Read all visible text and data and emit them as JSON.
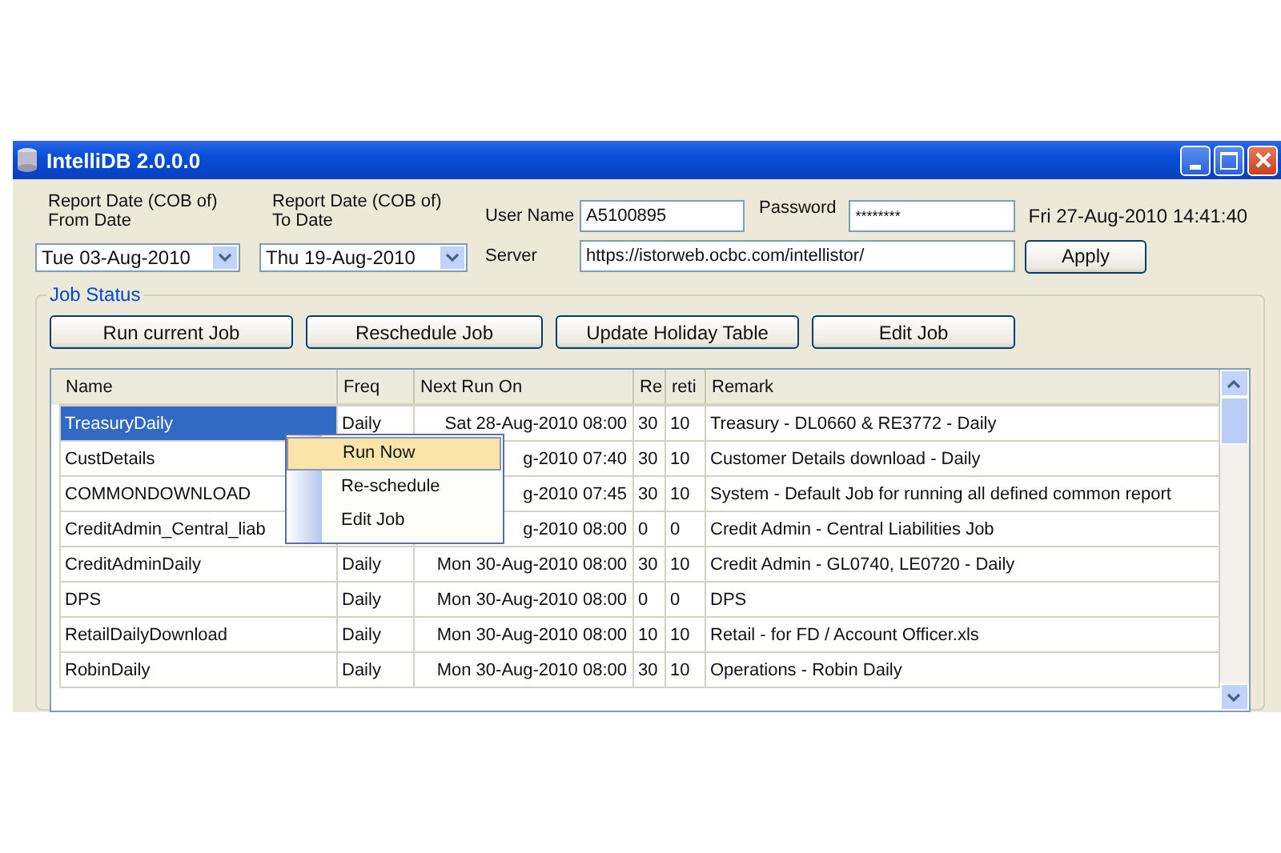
{
  "window": {
    "title": "IntelliDB 2.0.0.0"
  },
  "form": {
    "from_label": "Report Date (COB of)\nFrom Date",
    "from_value": "Tue 03-Aug-2010",
    "to_label": "Report Date (COB of)\nTo Date",
    "to_value": "Thu 19-Aug-2010",
    "user_label": "User Name",
    "user_value": "A5100895",
    "password_label": "Password",
    "password_value": "********",
    "datetime": "Fri 27-Aug-2010 14:41:40",
    "server_label": "Server",
    "server_value": "https://istorweb.ocbc.com/intellistor/",
    "apply": "Apply"
  },
  "job_status": {
    "title": "Job Status",
    "buttons": [
      "Run current Job",
      "Reschedule Job",
      "Update Holiday Table",
      "Edit Job"
    ],
    "table": {
      "columns": [
        "Name",
        "Freq",
        "Next Run On",
        "Re",
        "reti",
        "Remark"
      ],
      "rows": [
        {
          "cells": [
            "TreasuryDaily",
            "Daily",
            "Sat 28-Aug-2010 08:00",
            "30",
            "10",
            "Treasury - DL0660 & RE3772 - Daily"
          ],
          "selected": true
        },
        {
          "cells": [
            "CustDetails",
            null,
            "g-2010 07:40",
            "30",
            "10",
            "Customer Details download - Daily"
          ],
          "selected": false
        },
        {
          "cells": [
            "COMMONDOWNLOAD",
            null,
            "g-2010 07:45",
            "30",
            "10",
            "System - Default Job for running all defined common report"
          ],
          "selected": false
        },
        {
          "cells": [
            "CreditAdmin_Central_liab",
            null,
            "g-2010 08:00",
            "0",
            "0",
            "Credit Admin - Central Liabilities Job"
          ],
          "selected": false
        },
        {
          "cells": [
            "CreditAdminDaily",
            "Daily",
            "Mon 30-Aug-2010 08:00",
            "30",
            "10",
            "Credit Admin - GL0740, LE0720 - Daily"
          ],
          "selected": false
        },
        {
          "cells": [
            "DPS",
            "Daily",
            "Mon 30-Aug-2010 08:00",
            "0",
            "0",
            "DPS"
          ],
          "selected": false
        },
        {
          "cells": [
            "RetailDailyDownload",
            "Daily",
            "Mon 30-Aug-2010 08:00",
            "10",
            "10",
            "Retail - for FD / Account Officer.xls"
          ],
          "selected": false
        },
        {
          "cells": [
            "RobinDaily",
            "Daily",
            "Mon 30-Aug-2010 08:00",
            "30",
            "10",
            "Operations - Robin Daily"
          ],
          "selected": false
        }
      ]
    }
  },
  "context_menu": {
    "items": [
      {
        "label": "Run Now",
        "selected": true
      },
      {
        "label": "Re-schedule",
        "selected": false
      },
      {
        "label": "Edit Job",
        "selected": false
      }
    ]
  }
}
